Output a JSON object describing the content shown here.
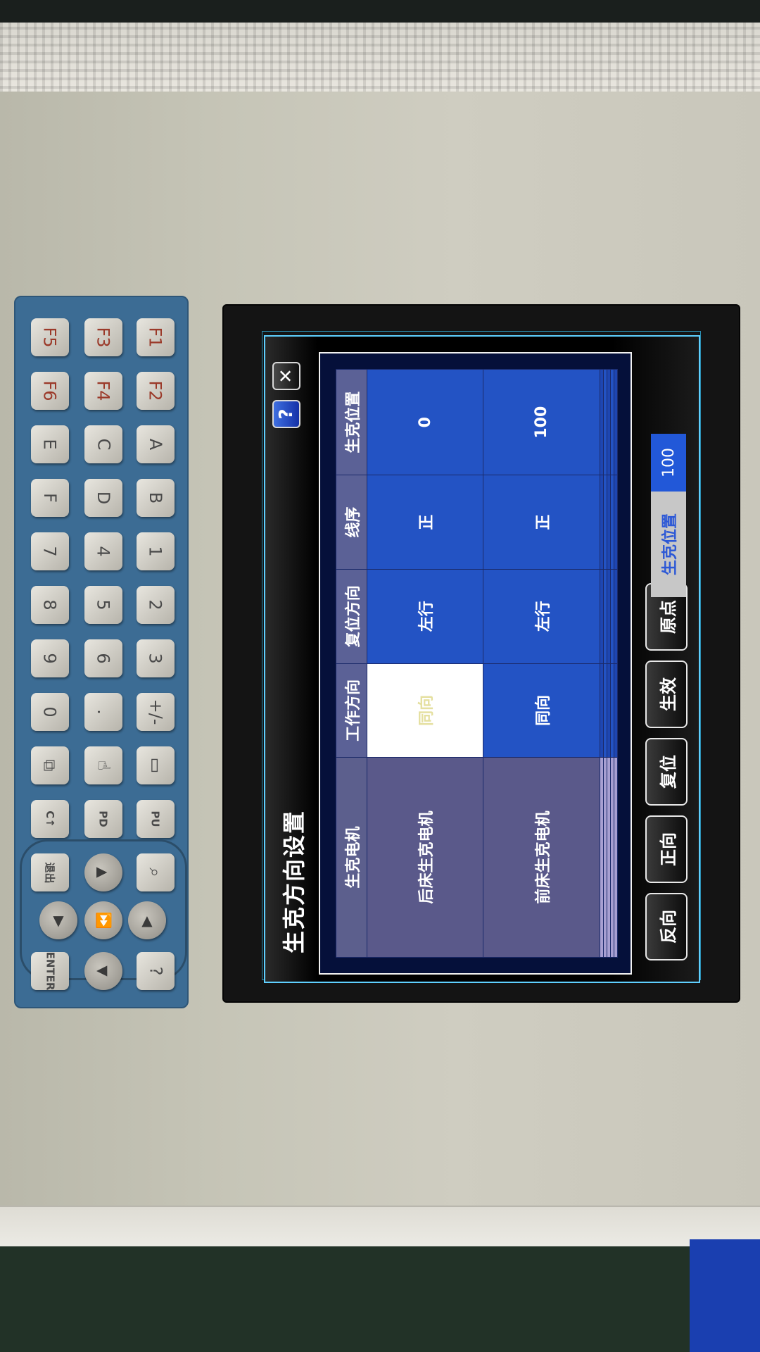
{
  "keypad": {
    "keys": [
      "F1",
      "F2",
      "F3",
      "F4",
      "F5",
      "F6",
      "A",
      "C",
      "E",
      "B",
      "D",
      "F",
      "1",
      "4",
      "7",
      "2",
      "5",
      "8",
      "3",
      "6",
      "9",
      "+/-",
      ".",
      "0"
    ],
    "icons": [
      "page-icon",
      "hand-icon",
      "copy-icon",
      "pu-icon",
      "pd-icon",
      "c-arrow-icon",
      "search-icon",
      "up-arrow-icon",
      "exit-icon",
      "right-arrow-icon",
      "play-icon",
      "left-arrow-icon",
      "help-key",
      "down-arrow-icon",
      "enter-icon"
    ],
    "labels": {
      "pu": "PU",
      "pd": "PD",
      "c_arrow": "C↑",
      "exit": "退出",
      "enter": "ENTER",
      "help": "?"
    }
  },
  "dialog": {
    "title": "生克方向设置",
    "help_label": "?",
    "close_label": "✕",
    "columns": [
      "生克电机",
      "工作方向",
      "复位方向",
      "线序",
      "生克位置"
    ],
    "rows": [
      [
        "后床生克电机",
        "同向",
        "左行",
        "正",
        "0"
      ],
      [
        "前床生克电机",
        "同向",
        "左行",
        "正",
        "100"
      ]
    ],
    "buttons": [
      "反向",
      "正向",
      "复位",
      "生效",
      "原点"
    ],
    "position_label": "生克位置",
    "position_value": "100"
  }
}
